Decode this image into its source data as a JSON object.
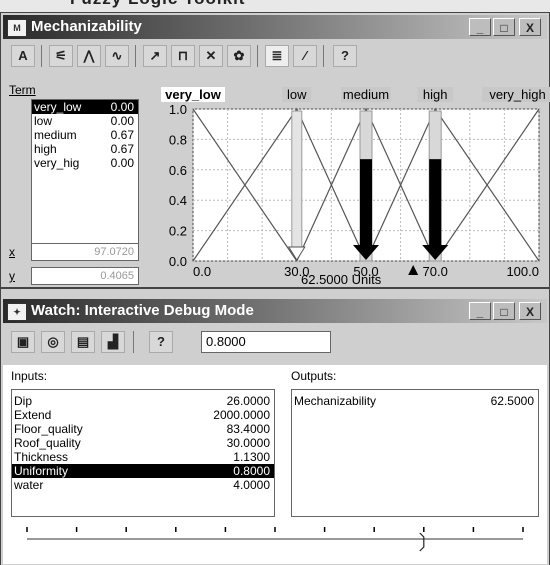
{
  "top_fragment": "Fuzzy Logic Toolkit",
  "mech_window": {
    "title": "Mechanizability",
    "window_buttons": [
      "_",
      "□",
      "X"
    ],
    "toolbar_icons": [
      "auto-scale-icon",
      "edit-term-icon",
      "add-term-icon",
      "wave-icon",
      "arrow-tool-icon",
      "term-tool-icon",
      "shape-tool-icon",
      "flower-icon",
      "list-view-icon",
      "curve-view-icon",
      "help-icon"
    ],
    "term_label": "Term",
    "terms": [
      {
        "name": "very_low",
        "value": "0.00"
      },
      {
        "name": "low",
        "value": "0.00"
      },
      {
        "name": "medium",
        "value": "0.67"
      },
      {
        "name": "high",
        "value": "0.67"
      },
      {
        "name": "very_hig",
        "value": "0.00"
      }
    ],
    "x_label": "x",
    "x_value": "97.0720",
    "y_label": "y",
    "y_value": "0.4065",
    "units_readout": "62.5000 Units"
  },
  "chart_data": {
    "type": "line",
    "title": "",
    "xlabel": "",
    "ylabel": "",
    "x_ticks": [
      "0.0",
      "30.0",
      "50.0",
      "70.0",
      "100.0"
    ],
    "y_ticks": [
      "0.0",
      "0.2",
      "0.4",
      "0.6",
      "0.8",
      "1.0"
    ],
    "xlim": [
      0,
      100
    ],
    "ylim": [
      0,
      1
    ],
    "grid": true,
    "term_labels": [
      "very_low",
      "low",
      "medium",
      "high",
      "very_high"
    ],
    "series": [
      {
        "name": "very_low",
        "x": [
          0,
          30
        ],
        "y": [
          1,
          0
        ]
      },
      {
        "name": "low",
        "x": [
          0,
          30,
          50
        ],
        "y": [
          0,
          1,
          0
        ]
      },
      {
        "name": "medium",
        "x": [
          30,
          50,
          70
        ],
        "y": [
          0,
          1,
          0
        ]
      },
      {
        "name": "high",
        "x": [
          50,
          70,
          100
        ],
        "y": [
          0,
          1,
          0
        ]
      },
      {
        "name": "very_high",
        "x": [
          70,
          100
        ],
        "y": [
          0,
          1
        ]
      }
    ],
    "memberships": [
      {
        "term": "very_low",
        "x": 0,
        "value": 0.0
      },
      {
        "term": "low",
        "x": 30,
        "value": 0.0
      },
      {
        "term": "medium",
        "x": 50,
        "value": 0.67
      },
      {
        "term": "high",
        "x": 70,
        "value": 0.67
      },
      {
        "term": "very_high",
        "x": 100,
        "value": 0.0
      }
    ],
    "highlighted_term": "very_low",
    "arrow_marker_x": 70
  },
  "watch_window": {
    "title": "Watch: Interactive Debug Mode",
    "window_buttons": [
      "_",
      "□",
      "X"
    ],
    "toolbar_icons": [
      "debug-icon",
      "globe-icon",
      "clipboard-icon",
      "chart-icon",
      "help-icon"
    ],
    "input_value": "0.8000",
    "inputs_label": "Inputs:",
    "outputs_label": "Outputs:",
    "inputs": [
      {
        "name": "Dip",
        "value": "26.0000"
      },
      {
        "name": "Extend",
        "value": "2000.0000"
      },
      {
        "name": "Floor_quality",
        "value": "83.4000"
      },
      {
        "name": "Roof_quality",
        "value": "30.0000"
      },
      {
        "name": "Thickness",
        "value": "1.1300"
      },
      {
        "name": "Uniformity",
        "value": "0.8000",
        "selected": true
      },
      {
        "name": "water",
        "value": "4.0000"
      }
    ],
    "outputs": [
      {
        "name": "Mechanizability",
        "value": "62.5000"
      }
    ],
    "slider": {
      "value_fraction": 0.8,
      "tick_count": 11
    }
  }
}
